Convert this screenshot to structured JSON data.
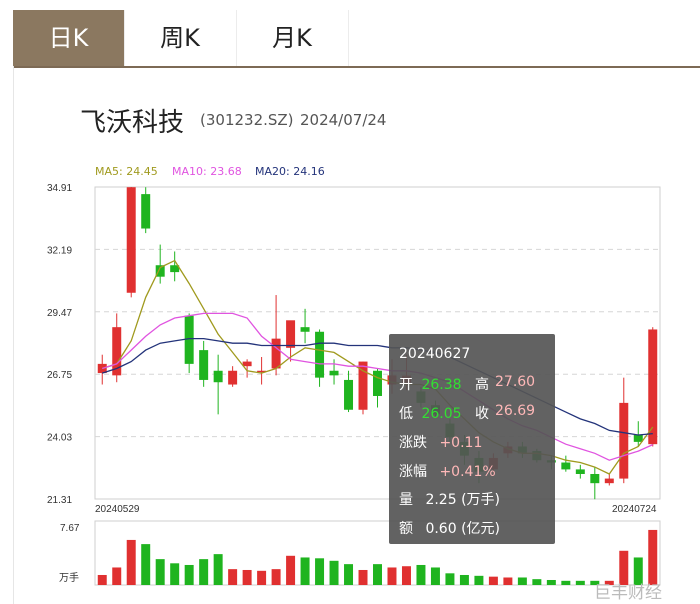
{
  "tabs": [
    {
      "label": "日K",
      "active": true
    },
    {
      "label": "周K",
      "active": false
    },
    {
      "label": "月K",
      "active": false
    }
  ],
  "stock": {
    "name": "飞沃科技",
    "code": "(301232.SZ)",
    "date": "2024/07/24"
  },
  "ma": {
    "ma5": {
      "label": "MA5: 24.45",
      "color": "#a09a1e"
    },
    "ma10": {
      "label": "MA10: 23.68",
      "color": "#e054e0"
    },
    "ma20": {
      "label": "MA20: 24.16",
      "color": "#23337a"
    }
  },
  "colors": {
    "up": "#e03030",
    "down": "#1fb41f",
    "accent": "#8b7860"
  },
  "chart_data": {
    "type": "candlestick",
    "y_ticks": [
      "34.91",
      "32.19",
      "29.47",
      "26.75",
      "24.03",
      "21.31"
    ],
    "y_range": [
      21.31,
      34.91
    ],
    "x_start_label": "20240529",
    "x_end_label": "20240724",
    "volume_label": "7.67",
    "volume_unit": "万手",
    "candles": [
      {
        "o": 26.8,
        "h": 27.6,
        "l": 26.3,
        "c": 27.2
      },
      {
        "o": 26.7,
        "h": 29.4,
        "l": 26.4,
        "c": 28.8
      },
      {
        "o": 30.3,
        "h": 34.91,
        "l": 30.1,
        "c": 34.9
      },
      {
        "o": 34.6,
        "h": 34.9,
        "l": 32.9,
        "c": 33.1
      },
      {
        "o": 31.5,
        "h": 32.4,
        "l": 30.7,
        "c": 31.0
      },
      {
        "o": 31.5,
        "h": 32.1,
        "l": 30.8,
        "c": 31.2
      },
      {
        "o": 29.3,
        "h": 29.4,
        "l": 26.8,
        "c": 27.2
      },
      {
        "o": 27.8,
        "h": 28.2,
        "l": 26.2,
        "c": 26.5
      },
      {
        "o": 26.9,
        "h": 27.6,
        "l": 25.0,
        "c": 26.4
      },
      {
        "o": 26.3,
        "h": 27.1,
        "l": 26.2,
        "c": 26.9
      },
      {
        "o": 27.1,
        "h": 27.4,
        "l": 26.6,
        "c": 27.3
      },
      {
        "o": 26.9,
        "h": 27.5,
        "l": 26.3,
        "c": 26.9
      },
      {
        "o": 27.0,
        "h": 30.2,
        "l": 26.7,
        "c": 28.3
      },
      {
        "o": 27.9,
        "h": 29.0,
        "l": 27.3,
        "c": 29.1
      },
      {
        "o": 28.8,
        "h": 29.6,
        "l": 28.1,
        "c": 28.6
      },
      {
        "o": 28.6,
        "h": 28.7,
        "l": 26.2,
        "c": 26.6
      },
      {
        "o": 26.9,
        "h": 27.4,
        "l": 26.3,
        "c": 26.7
      },
      {
        "o": 26.5,
        "h": 26.9,
        "l": 25.1,
        "c": 25.2
      },
      {
        "o": 25.2,
        "h": 27.3,
        "l": 25.0,
        "c": 27.3
      },
      {
        "o": 26.9,
        "h": 27.0,
        "l": 25.3,
        "c": 25.8
      },
      {
        "o": 26.3,
        "h": 27.4,
        "l": 25.9,
        "c": 26.7
      },
      {
        "o": 26.38,
        "h": 27.6,
        "l": 26.05,
        "c": 26.69
      },
      {
        "o": 26.0,
        "h": 26.2,
        "l": 25.3,
        "c": 25.5
      },
      {
        "o": 25.4,
        "h": 25.6,
        "l": 24.9,
        "c": 25.0
      },
      {
        "o": 24.6,
        "h": 24.8,
        "l": 23.8,
        "c": 24.0
      },
      {
        "o": 23.8,
        "h": 24.1,
        "l": 22.8,
        "c": 23.2
      },
      {
        "o": 23.1,
        "h": 23.4,
        "l": 22.0,
        "c": 22.5
      },
      {
        "o": 22.6,
        "h": 23.3,
        "l": 22.3,
        "c": 23.1
      },
      {
        "o": 23.3,
        "h": 23.8,
        "l": 23.1,
        "c": 23.6
      },
      {
        "o": 23.6,
        "h": 23.8,
        "l": 23.1,
        "c": 23.3
      },
      {
        "o": 23.4,
        "h": 23.5,
        "l": 22.9,
        "c": 23.0
      },
      {
        "o": 23.0,
        "h": 23.2,
        "l": 22.6,
        "c": 22.9
      },
      {
        "o": 22.9,
        "h": 23.2,
        "l": 22.5,
        "c": 22.6
      },
      {
        "o": 22.6,
        "h": 22.8,
        "l": 22.2,
        "c": 22.4
      },
      {
        "o": 22.4,
        "h": 22.7,
        "l": 21.3,
        "c": 22.0
      },
      {
        "o": 22.0,
        "h": 22.4,
        "l": 21.9,
        "c": 22.2
      },
      {
        "o": 22.2,
        "h": 26.6,
        "l": 22.0,
        "c": 25.5
      },
      {
        "o": 24.1,
        "h": 24.7,
        "l": 23.6,
        "c": 23.8
      },
      {
        "o": 23.7,
        "h": 28.8,
        "l": 23.6,
        "c": 28.7
      }
    ],
    "volumes": [
      1.2,
      2.1,
      5.4,
      4.9,
      3.1,
      2.6,
      2.4,
      3.1,
      3.7,
      1.9,
      1.8,
      1.7,
      1.9,
      3.5,
      3.3,
      3.2,
      2.9,
      2.5,
      1.8,
      2.5,
      2.1,
      2.25,
      2.4,
      2.1,
      1.4,
      1.2,
      1.1,
      1.0,
      0.9,
      0.9,
      0.7,
      0.6,
      0.5,
      0.5,
      0.5,
      0.5,
      4.1,
      3.3,
      6.6
    ],
    "ma5": [
      27.0,
      27.2,
      28.2,
      30.1,
      31.4,
      31.7,
      30.7,
      29.6,
      28.5,
      27.7,
      26.9,
      26.8,
      27.0,
      27.5,
      27.9,
      27.8,
      27.7,
      27.3,
      26.9,
      26.6,
      26.4,
      26.3,
      26.3,
      26.1,
      25.4,
      24.8,
      24.2,
      23.8,
      23.5,
      23.3,
      23.3,
      23.2,
      23.0,
      22.9,
      22.7,
      22.4,
      23.3,
      23.6,
      24.45
    ],
    "ma10": [
      27.0,
      27.2,
      27.8,
      28.4,
      28.9,
      29.2,
      29.3,
      29.4,
      29.4,
      29.4,
      29.2,
      28.4,
      27.9,
      27.4,
      27.3,
      27.2,
      27.2,
      27.1,
      27.1,
      27.0,
      26.9,
      26.9,
      26.8,
      26.6,
      26.4,
      26.0,
      25.6,
      25.2,
      24.8,
      24.5,
      24.3,
      24.0,
      23.7,
      23.5,
      23.3,
      23.0,
      23.2,
      23.4,
      23.68
    ],
    "ma20": [
      26.8,
      27.0,
      27.3,
      27.8,
      28.1,
      28.2,
      28.3,
      28.3,
      28.2,
      28.1,
      28.1,
      28.0,
      28.0,
      28.0,
      28.0,
      28.1,
      28.1,
      28.0,
      28.0,
      28.0,
      27.9,
      27.9,
      27.8,
      27.7,
      27.5,
      27.2,
      26.9,
      26.6,
      26.3,
      26.0,
      25.7,
      25.4,
      25.1,
      24.8,
      24.6,
      24.3,
      24.2,
      24.1,
      24.16
    ]
  },
  "tooltip": {
    "date": "20240627",
    "open_label": "开",
    "open": "26.38",
    "high_label": "高",
    "high": "27.60",
    "low_label": "低",
    "low": "26.05",
    "close_label": "收",
    "close": "26.69",
    "change_label": "涨跌",
    "change": "+0.11",
    "pct_label": "涨幅",
    "pct": "+0.41%",
    "vol_label": "量",
    "vol": "2.25 (万手)",
    "amt_label": "额",
    "amt": "0.60 (亿元)"
  },
  "watermark": "巨丰财经"
}
